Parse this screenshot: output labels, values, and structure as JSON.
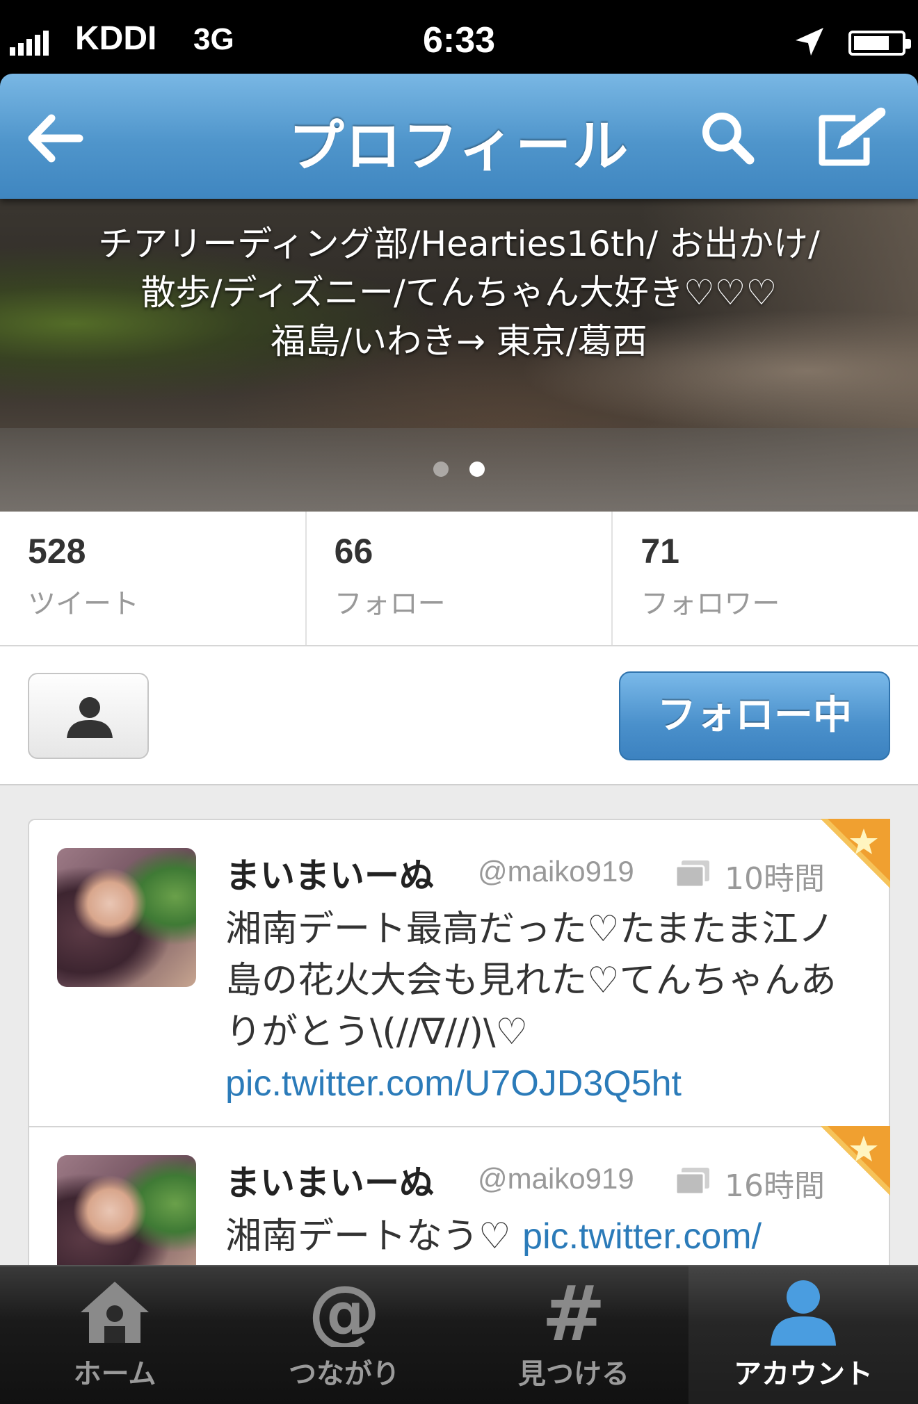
{
  "status_bar": {
    "carrier": "KDDI",
    "network": "3G",
    "time": "6:33",
    "icons": [
      "signal-icon",
      "location-arrow-icon",
      "battery-icon"
    ]
  },
  "nav": {
    "title": "プロフィール",
    "icons": [
      "back-arrow-icon",
      "search-icon",
      "compose-icon"
    ],
    "accent": "#4f95cb"
  },
  "profile": {
    "bio_lines": [
      "チアリーディング部/Hearties16th/ お出かけ/",
      "散歩/ディズニー/てんちゃん大好き♡♡♡",
      "福島/いわき→ 東京/葛西"
    ],
    "page_indicator": {
      "pages": 2,
      "current": 2
    }
  },
  "stats": [
    {
      "count": "528",
      "label": "ツイート"
    },
    {
      "count": "66",
      "label": "フォロー"
    },
    {
      "count": "71",
      "label": "フォロワー"
    }
  ],
  "actions": {
    "follow_label": "フォロー中",
    "user_icon": "person-icon"
  },
  "tweets": [
    {
      "name": "まいまいーぬ",
      "handle": "@maiko919",
      "time": "10時間",
      "text": "湘南デート最高だった♡たまたま江ノ島の花火大会も見れた♡てんちゃんありがとう\\(//∇//)\\♡",
      "link": "pic.twitter.com/U7OJD3Q5ht",
      "favorited": true
    },
    {
      "name": "まいまいーぬ",
      "handle": "@maiko919",
      "time": "16時間",
      "text": "湘南デートなう♡ ",
      "link": "pic.twitter.com/",
      "favorited": true
    }
  ],
  "tabs": [
    {
      "label": "ホーム",
      "icon": "home-icon",
      "active": false
    },
    {
      "label": "つながり",
      "icon": "at-icon",
      "active": false
    },
    {
      "label": "見つける",
      "icon": "hash-icon",
      "active": false
    },
    {
      "label": "アカウント",
      "icon": "account-icon",
      "active": true
    }
  ]
}
